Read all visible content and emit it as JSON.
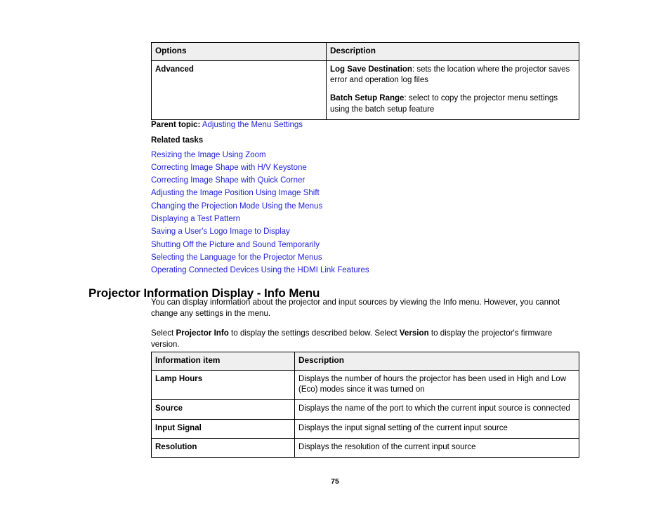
{
  "options_table": {
    "name": "options-table",
    "headers": [
      "Options",
      "Description"
    ],
    "rows": [
      {
        "item": "Advanced",
        "paragraphs": [
          {
            "bold": "Log Save Destination",
            "rest": ": sets the location where the projector saves error and operation log files"
          },
          {
            "bold": "Batch Setup Range",
            "rest": ": select to copy the projector menu settings using the batch setup feature"
          }
        ]
      }
    ]
  },
  "topic": {
    "parent_label": "Parent topic:",
    "parent_link": "Adjusting the Menu Settings",
    "related_heading": "Related tasks",
    "related_links": [
      "Resizing the Image Using Zoom",
      "Correcting Image Shape with H/V Keystone",
      "Correcting Image Shape with Quick Corner",
      "Adjusting the Image Position Using Image Shift",
      "Changing the Projection Mode Using the Menus",
      "Displaying a Test Pattern",
      "Saving a User's Logo Image to Display",
      "Shutting Off the Picture and Sound Temporarily",
      "Selecting the Language for the Projector Menus",
      "Operating Connected Devices Using the HDMI Link Features"
    ]
  },
  "section": {
    "heading": "Projector Information Display - Info Menu",
    "paragraph_1": "You can display information about the projector and input sources by viewing the Info menu. However, you cannot change any settings in the menu.",
    "paragraph_2": {
      "part_1": "Select ",
      "bold_1": "Projector Info",
      "part_2": " to display the settings described below. Select ",
      "bold_2": "Version",
      "part_3": " to display the projector's firmware version."
    }
  },
  "info_table": {
    "name": "information-item-table",
    "headers": [
      "Information item",
      "Description"
    ],
    "rows": [
      {
        "item": "Lamp Hours",
        "description": "Displays the number of hours the projector has been used in High and Low (Eco) modes since it was turned on"
      },
      {
        "item": "Source",
        "description": "Displays the name of the port to which the current input source is connected"
      },
      {
        "item": "Input Signal",
        "description": "Displays the input signal setting of the current input source"
      },
      {
        "item": "Resolution",
        "description": "Displays the resolution of the current input source"
      }
    ]
  },
  "footer": {
    "page_number": "75"
  },
  "colors": {
    "link": "#2222dd",
    "table_header_bg": "#efefef",
    "border": "#000000",
    "text": "#000000"
  }
}
